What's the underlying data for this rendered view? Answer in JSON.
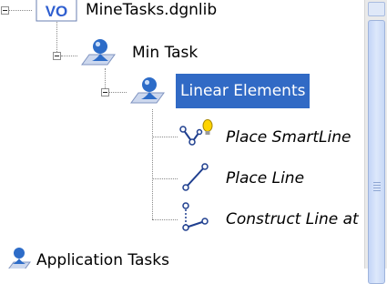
{
  "tree": {
    "root_file": {
      "icon": "vo-file-icon",
      "icon_text": "VO",
      "label": "MineTasks.dgnlib"
    },
    "min_task": {
      "icon": "task-folder-icon",
      "label": "Min Task",
      "expanded": true
    },
    "linear_elements": {
      "icon": "task-folder-icon",
      "label": "Linear Elements",
      "expanded": true,
      "selected": true
    },
    "tools": [
      {
        "icon": "smartline-icon",
        "label": "Place SmartLine"
      },
      {
        "icon": "place-line-icon",
        "label": "Place Line"
      },
      {
        "icon": "construct-line-icon",
        "label": "Construct Line at"
      }
    ],
    "application_tasks": {
      "icon": "app-tasks-icon",
      "label": "Application Tasks"
    }
  },
  "colors": {
    "selection": "#316ac5",
    "accent_blue": "#2f5fd0"
  }
}
